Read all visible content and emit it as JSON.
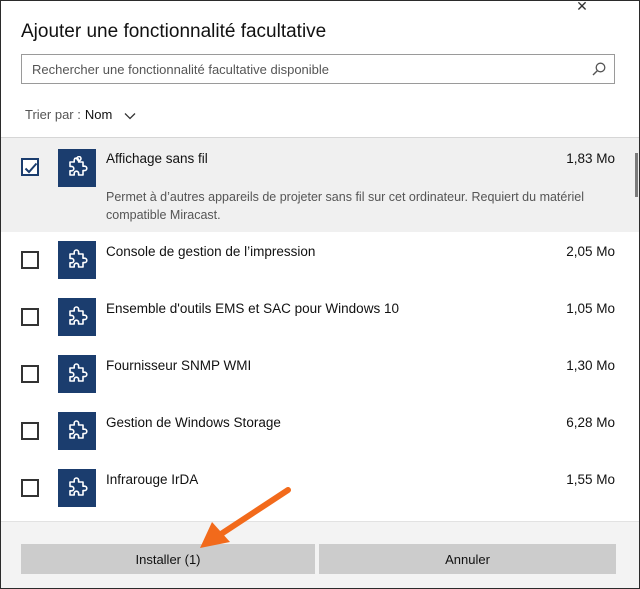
{
  "dialog": {
    "title": "Ajouter une fonctionnalité facultative",
    "close_glyph": "✕"
  },
  "search": {
    "placeholder": "Rechercher une fonctionnalité facultative disponible"
  },
  "sort": {
    "label": "Trier par :",
    "value": "Nom"
  },
  "features": [
    {
      "name": "Affichage sans fil",
      "size": "1,83 Mo",
      "checked": true,
      "description": "Permet à d’autres appareils de projeter sans fil sur cet ordinateur. Requiert du matériel compatible Miracast."
    },
    {
      "name": "Console de gestion de l’impression",
      "size": "2,05 Mo",
      "checked": false
    },
    {
      "name": "Ensemble d'outils EMS et SAC pour Windows 10",
      "size": "1,05 Mo",
      "checked": false
    },
    {
      "name": "Fournisseur SNMP WMI",
      "size": "1,30 Mo",
      "checked": false
    },
    {
      "name": "Gestion de Windows Storage",
      "size": "6,28 Mo",
      "checked": false
    },
    {
      "name": "Infrarouge IrDA",
      "size": "1,55 Mo",
      "checked": false
    }
  ],
  "footer": {
    "install_label": "Installer (1)",
    "cancel_label": "Annuler"
  },
  "icons": {
    "feature_tile": "puzzle-piece-icon",
    "checkmark": "checkmark-icon",
    "search": "search-icon",
    "sort_chevron": "chevron-down-icon",
    "annotation": "orange-arrow"
  },
  "colors": {
    "tile_background": "#1b3d6e",
    "checkmark": "#1b3d6e",
    "selected_row": "#f0f0f0",
    "button": "#cccccc",
    "footer": "#f3f3f3",
    "annotation_arrow": "#f26a1b"
  }
}
